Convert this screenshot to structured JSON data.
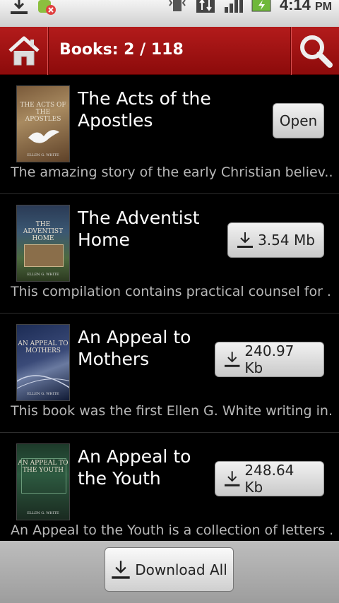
{
  "status_bar": {
    "time": "4:14",
    "ampm": "PM",
    "icons": [
      "download-icon",
      "android-alert-icon",
      "vibrate-icon",
      "data-transfer-icon",
      "signal-icon",
      "battery-charging-icon"
    ]
  },
  "header": {
    "title": "Books: 2 / 118",
    "home_icon": "home-icon",
    "search_icon": "search-icon",
    "accent": "#a51212"
  },
  "books": [
    {
      "title": "The Acts of the Apostles",
      "cover_title": "THE ACTS OF THE APOSTLES",
      "cover_author": "ELLEN G. WHITE",
      "description": "The amazing story of the early Christian believ...",
      "action": "Open",
      "action_type": "open"
    },
    {
      "title": "The Adventist Home",
      "cover_title": "THE ADVENTIST HOME",
      "cover_author": "ELLEN G. WHITE",
      "description": "This compilation contains practical counsel for ...",
      "action": "3.54 Mb",
      "action_type": "download"
    },
    {
      "title": "An Appeal to Mothers",
      "cover_title": "AN APPEAL TO MOTHERS",
      "cover_author": "ELLEN G. WHITE",
      "description": "This book was the first Ellen G. White writing in...",
      "action": "240.97 Kb",
      "action_type": "download"
    },
    {
      "title": "An Appeal to the Youth",
      "cover_title": "AN APPEAL TO THE YOUTH",
      "cover_author": "ELLEN G. WHITE",
      "description": "An Appeal to the Youth is a collection of letters ...",
      "action": "248.64 Kb",
      "action_type": "download"
    }
  ],
  "footer": {
    "download_all": "Download All"
  }
}
